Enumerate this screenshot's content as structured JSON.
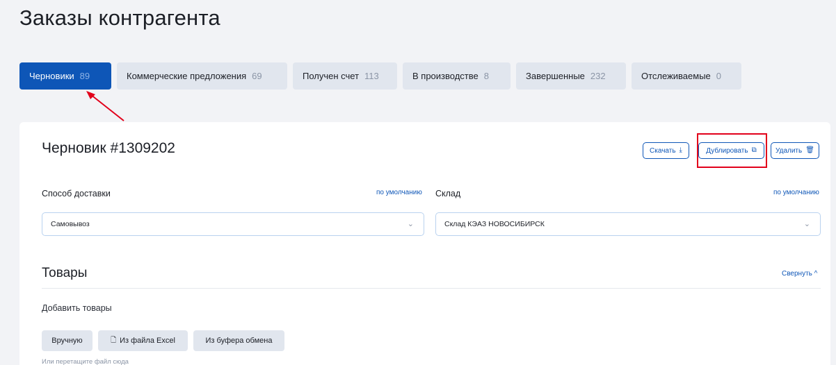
{
  "page": {
    "title": "Заказы контрагента"
  },
  "tabs": [
    {
      "label": "Черновики",
      "count": "89",
      "active": true
    },
    {
      "label": "Коммерческие предложения",
      "count": "69",
      "active": false
    },
    {
      "label": "Получен счет",
      "count": "113",
      "active": false
    },
    {
      "label": "В производстве",
      "count": "8",
      "active": false
    },
    {
      "label": "Завершенные",
      "count": "232",
      "active": false
    },
    {
      "label": "Отслеживаемые",
      "count": "0",
      "active": false
    }
  ],
  "draft": {
    "title": "Черновик #1309202",
    "actions": {
      "download_label": "Скачать",
      "duplicate_label": "Дублировать",
      "delete_label": "Удалить"
    }
  },
  "delivery": {
    "label": "Способ доставки",
    "default_link": "по умолчанию",
    "value": "Самовывоз"
  },
  "warehouse": {
    "label": "Склад",
    "default_link": "по умолчанию",
    "value": "Склад КЭАЗ НОВОСИБИРСК"
  },
  "goods": {
    "title": "Товары",
    "collapse_label": "Свернуть",
    "add_label": "Добавить товары",
    "buttons": {
      "manual": "Вручную",
      "excel": "Из файла Excel",
      "clipboard": "Из буфера обмена"
    },
    "drop_hint": "Или перетащите файл сюда"
  },
  "icons": {
    "download": "download-icon",
    "duplicate": "copy-icon",
    "delete": "trash-icon",
    "chevron": "chevron-down-icon",
    "collapse": "chevron-up-icon",
    "excel": "file-icon"
  },
  "colors": {
    "accent": "#0e56b7",
    "annotation": "#e2001a",
    "tab_inactive": "#e1e6ee",
    "background": "#f2f3f6"
  }
}
